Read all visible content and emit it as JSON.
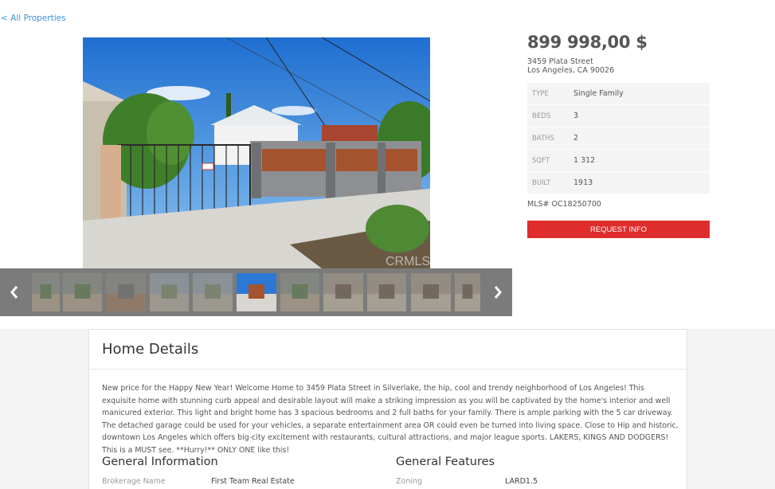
{
  "nav": {
    "back_label": "< All Properties"
  },
  "listing": {
    "price": "899 998,00 $",
    "address_line1": "3459 Plata Street",
    "address_line2": "Los Angeles, CA 90026",
    "facts": [
      {
        "key": "TYPE",
        "value": "Single Family"
      },
      {
        "key": "BEDS",
        "value": "3"
      },
      {
        "key": "BATHS",
        "value": "2"
      },
      {
        "key": "SQFT",
        "value": "1 312"
      },
      {
        "key": "BUILT",
        "value": "1913"
      }
    ],
    "mls": "MLS# OC18250700",
    "request_label": "REQUEST INFO"
  },
  "gallery": {
    "watermark": "CRMLS",
    "thumbnails": [
      {
        "icon": "photo-yard"
      },
      {
        "icon": "photo-yard"
      },
      {
        "icon": "photo-gate"
      },
      {
        "icon": "photo-aerial"
      },
      {
        "icon": "photo-aerial"
      },
      {
        "icon": "photo-front",
        "active": true
      },
      {
        "icon": "photo-yard"
      },
      {
        "icon": "photo-room"
      },
      {
        "icon": "photo-room"
      },
      {
        "icon": "photo-room"
      },
      {
        "icon": "photo-room"
      }
    ]
  },
  "details": {
    "title": "Home Details",
    "description": "New price for the Happy New Year! Welcome Home to 3459 Plata Street in Silverlake, the hip, cool and trendy neighborhood of Los Angeles! This exquisite home with stunning curb appeal and desirable layout will make a striking impression as you will be captivated by the home's interior and well manicured exterior. This light and bright home has 3 spacious bedrooms and 2 full baths for your family. There is ample parking with the 5 car driveway. The detached garage could be used for your vehicles, a separate entertainment area OR could even be turned into living space. Close to Hip and historic, downtown Los Angeles which offers big-city excitement with restaurants, cultural attractions, and major league sports. LAKERS, KINGS AND DODGERS! This is a MUST see. **Hurry!** ONLY ONE like this!",
    "general_info_title": "General Information",
    "general_features_title": "General Features",
    "brokerage_key": "Brokerage Name",
    "brokerage_value": "First Team Real Estate",
    "zoning_key": "Zoning",
    "zoning_value": "LARD1.5"
  },
  "colors": {
    "accent": "#df2c2c",
    "link": "#3b8fd9",
    "strip": "#7b7b7b"
  }
}
